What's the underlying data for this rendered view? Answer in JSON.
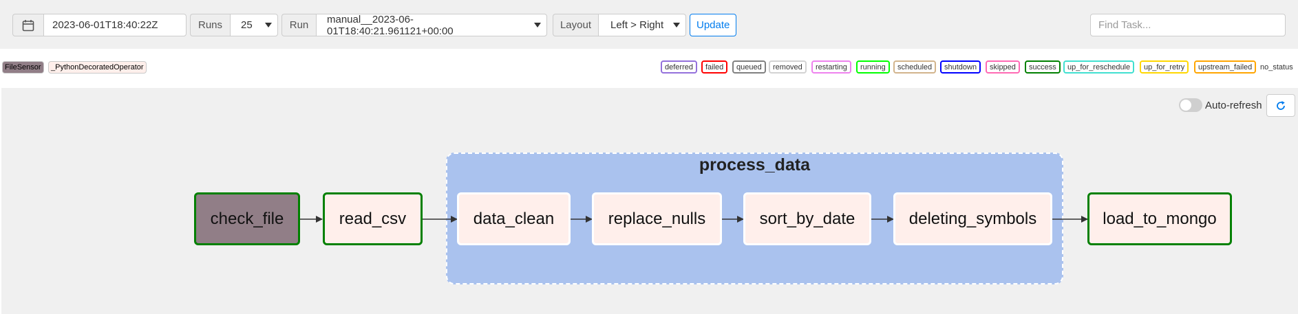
{
  "toolbar": {
    "date_value": "2023-06-01T18:40:22Z",
    "runs_label": "Runs",
    "runs_value": "25",
    "run_label": "Run",
    "run_value": "manual__2023-06-01T18:40:21.961121+00:00",
    "layout_label": "Layout",
    "layout_value": "Left > Right",
    "update_label": "Update",
    "find_placeholder": "Find Task...",
    "calendar_icon": "calendar-icon"
  },
  "operators": [
    {
      "label": "FileSensor",
      "color": "#917e87"
    },
    {
      "label": "_PythonDecoratedOperator",
      "color": "#ffefeb"
    }
  ],
  "states": [
    {
      "label": "deferred",
      "color": "#9370db"
    },
    {
      "label": "failed",
      "color": "#ff0000"
    },
    {
      "label": "queued",
      "color": "#808080"
    },
    {
      "label": "removed",
      "color": "#d3d3d3"
    },
    {
      "label": "restarting",
      "color": "#ee82ee"
    },
    {
      "label": "running",
      "color": "#00ff00"
    },
    {
      "label": "scheduled",
      "color": "#d2b48c"
    },
    {
      "label": "shutdown",
      "color": "#0000ff"
    },
    {
      "label": "skipped",
      "color": "#ff69b4"
    },
    {
      "label": "success",
      "color": "#008000"
    },
    {
      "label": "up_for_reschedule",
      "color": "#40e0d0"
    },
    {
      "label": "up_for_retry",
      "color": "#ffd700"
    },
    {
      "label": "upstream_failed",
      "color": "#ffa500"
    },
    {
      "label": "no_status",
      "color": "#ffffff"
    }
  ],
  "graph": {
    "auto_refresh_label": "Auto-refresh",
    "auto_refresh_on": false,
    "refresh_icon": "refresh-icon",
    "task_group_title": "process_data",
    "tasks": {
      "check_file": "check_file",
      "read_csv": "read_csv",
      "data_clean": "data_clean",
      "replace_nulls": "replace_nulls",
      "sort_by_date": "sort_by_date",
      "deleting_symbols": "deleting_symbols",
      "load_to_mongo": "load_to_mongo"
    }
  }
}
